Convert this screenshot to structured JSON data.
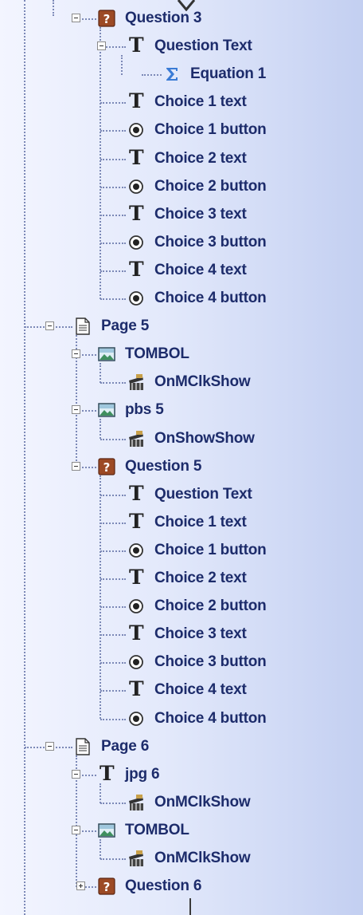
{
  "tree": {
    "items": [
      {
        "label": "Question 3",
        "level": 1,
        "icon": "question-icon",
        "toggle": "collapse"
      },
      {
        "label": "Question Text",
        "level": 2,
        "icon": "text-icon",
        "toggle": "collapse"
      },
      {
        "label": "Equation 1",
        "level": 3,
        "icon": "sigma-icon",
        "toggle": "none"
      },
      {
        "label": "Choice 1 text",
        "level": 2,
        "icon": "text-icon",
        "toggle": "none"
      },
      {
        "label": "Choice 1 button",
        "level": 2,
        "icon": "radio-icon",
        "toggle": "none"
      },
      {
        "label": "Choice 2 text",
        "level": 2,
        "icon": "text-icon",
        "toggle": "none"
      },
      {
        "label": "Choice 2 button",
        "level": 2,
        "icon": "radio-icon",
        "toggle": "none"
      },
      {
        "label": "Choice 3 text",
        "level": 2,
        "icon": "text-icon",
        "toggle": "none"
      },
      {
        "label": "Choice 3 button",
        "level": 2,
        "icon": "radio-icon",
        "toggle": "none"
      },
      {
        "label": "Choice 4 text",
        "level": 2,
        "icon": "text-icon",
        "toggle": "none"
      },
      {
        "label": "Choice 4 button",
        "level": 2,
        "icon": "radio-icon",
        "toggle": "none"
      },
      {
        "label": "Page 5",
        "level": 0,
        "icon": "page-icon",
        "toggle": "collapse"
      },
      {
        "label": "TOMBOL",
        "level": 1,
        "icon": "image-icon",
        "toggle": "collapse"
      },
      {
        "label": "OnMClkShow",
        "level": 2,
        "icon": "action-icon",
        "toggle": "none"
      },
      {
        "label": "pbs 5",
        "level": 1,
        "icon": "image-icon",
        "toggle": "collapse"
      },
      {
        "label": "OnShowShow",
        "level": 2,
        "icon": "action-icon",
        "toggle": "none"
      },
      {
        "label": "Question 5",
        "level": 1,
        "icon": "question-icon",
        "toggle": "collapse"
      },
      {
        "label": "Question Text",
        "level": 2,
        "icon": "text-icon",
        "toggle": "none"
      },
      {
        "label": "Choice 1 text",
        "level": 2,
        "icon": "text-icon",
        "toggle": "none"
      },
      {
        "label": "Choice 1 button",
        "level": 2,
        "icon": "radio-icon",
        "toggle": "none"
      },
      {
        "label": "Choice 2 text",
        "level": 2,
        "icon": "text-icon",
        "toggle": "none"
      },
      {
        "label": "Choice 2 button",
        "level": 2,
        "icon": "radio-icon",
        "toggle": "none"
      },
      {
        "label": "Choice 3 text",
        "level": 2,
        "icon": "text-icon",
        "toggle": "none"
      },
      {
        "label": "Choice 3 button",
        "level": 2,
        "icon": "radio-icon",
        "toggle": "none"
      },
      {
        "label": "Choice 4 text",
        "level": 2,
        "icon": "text-icon",
        "toggle": "none"
      },
      {
        "label": "Choice 4 button",
        "level": 2,
        "icon": "radio-icon",
        "toggle": "none"
      },
      {
        "label": "Page 6",
        "level": 0,
        "icon": "page-icon",
        "toggle": "collapse"
      },
      {
        "label": "jpg 6",
        "level": 1,
        "icon": "text-icon",
        "toggle": "collapse"
      },
      {
        "label": "OnMClkShow",
        "level": 2,
        "icon": "action-icon",
        "toggle": "none"
      },
      {
        "label": "TOMBOL",
        "level": 1,
        "icon": "image-icon",
        "toggle": "collapse"
      },
      {
        "label": "OnMClkShow",
        "level": 2,
        "icon": "action-icon",
        "toggle": "none"
      },
      {
        "label": "Question 6",
        "level": 1,
        "icon": "question-icon",
        "toggle": "expand"
      }
    ]
  },
  "colors": {
    "label": "#1d2c6b",
    "background": "#dfe6fa",
    "connector": "#7c89b7",
    "question_icon": "#8a3b1f",
    "sigma": "#3a7bd5"
  }
}
